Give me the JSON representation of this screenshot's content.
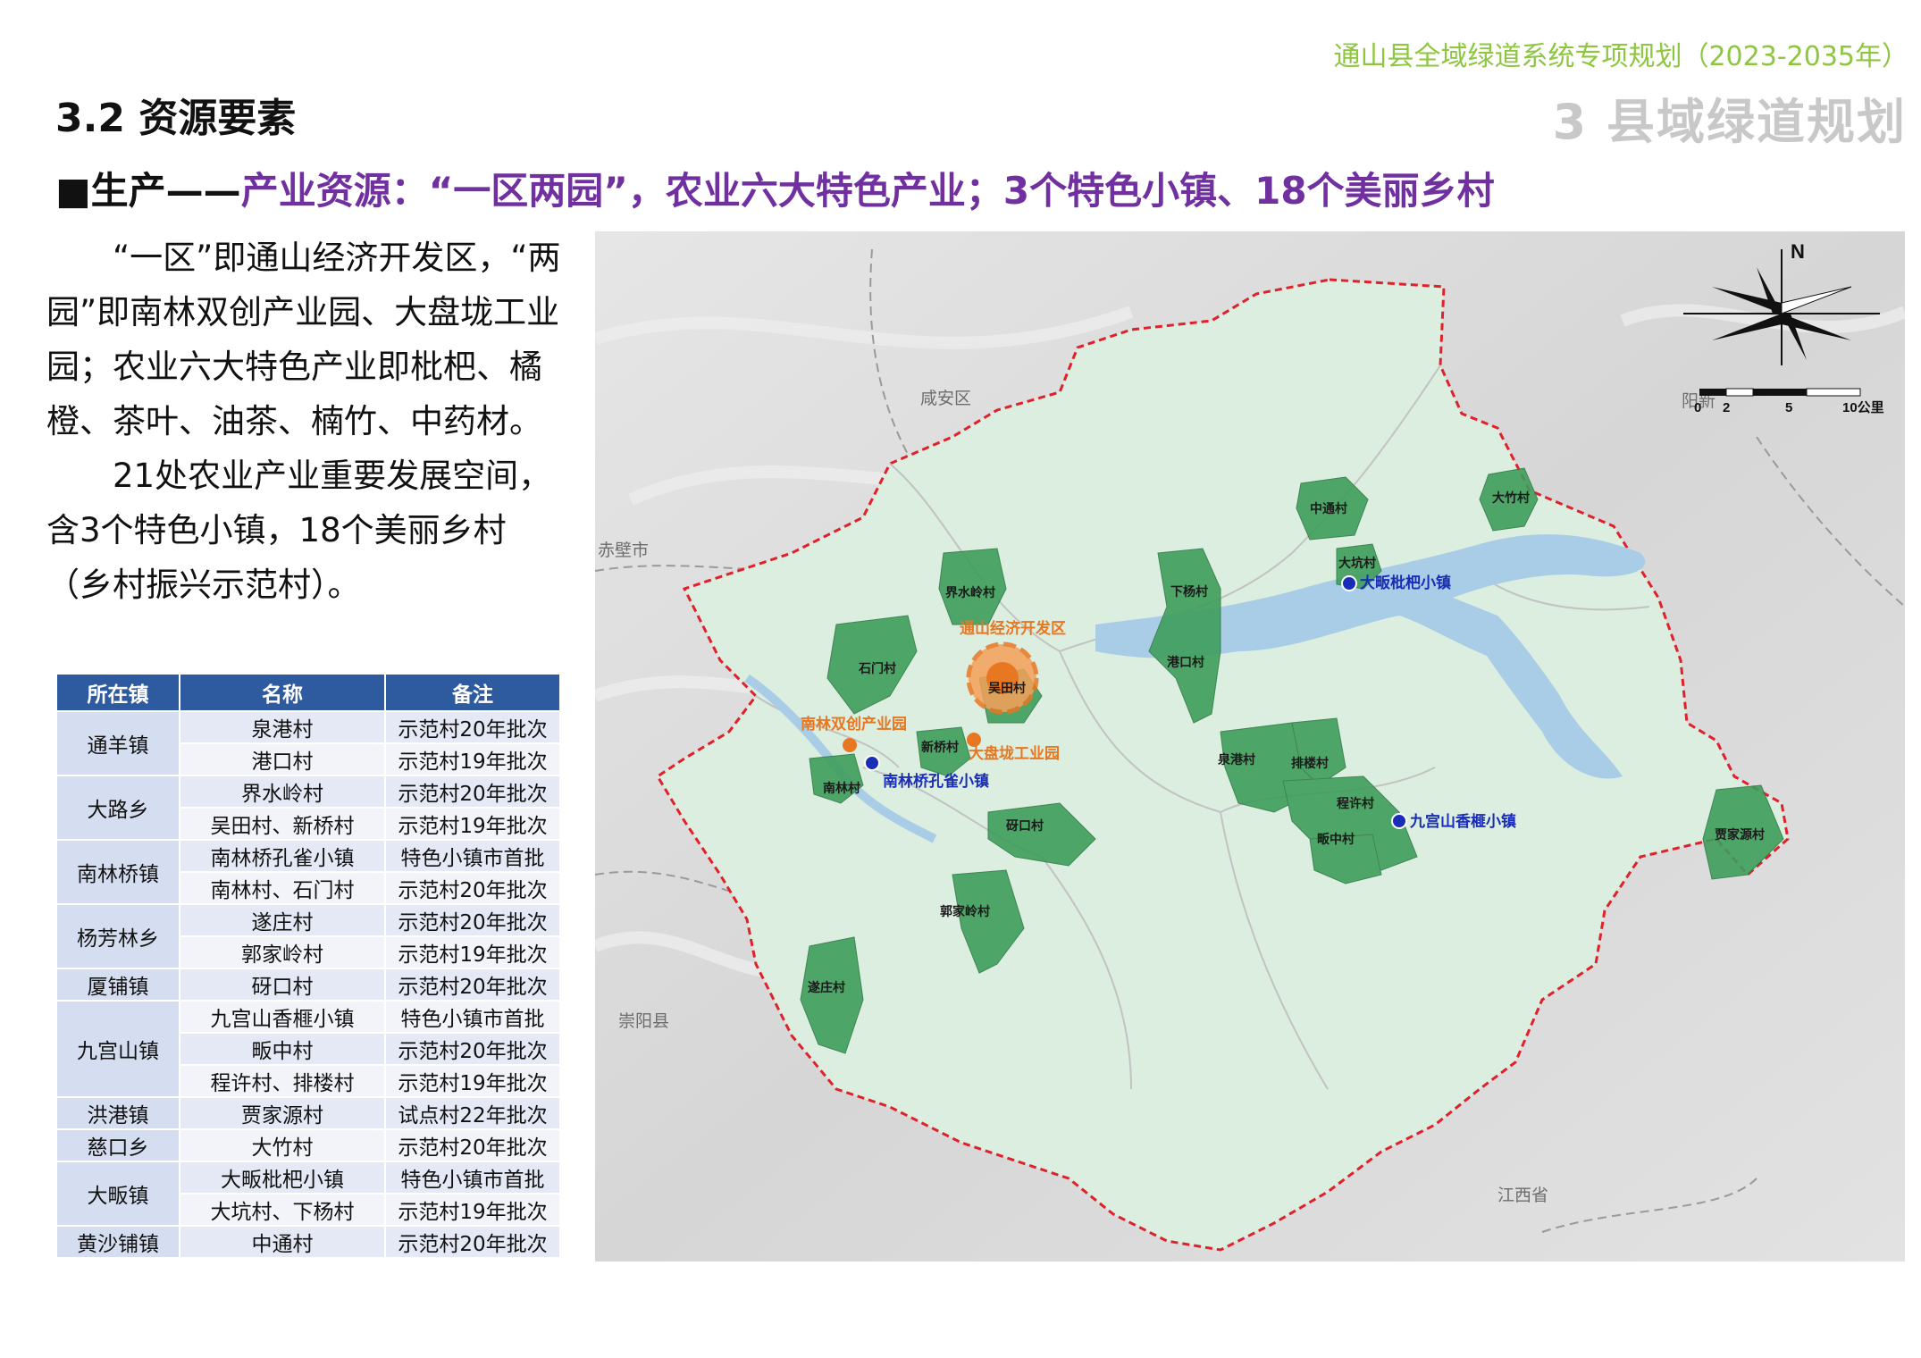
{
  "header": {
    "doc_title": "通山县全域绿道系统专项规划（2023-2035年）",
    "section_title": "3.2  资源要素",
    "chapter_title": "3  县域绿道规划"
  },
  "headline": {
    "lead": "■生产——",
    "highlight": "产业资源：“一区两园”，农业六大特色产业；3个特色小镇、18个美丽乡村"
  },
  "body": {
    "paragraph1": "“一区”即通山经济开发区，“两园”即南林双创产业园、大盘垅工业园；农业六大特色产业即枇杷、橘橙、茶叶、油茶、楠竹、中药材。",
    "paragraph2": "21处农业产业重要发展空间，含3个特色小镇，18个美丽乡村（乡村振兴示范村）。"
  },
  "table": {
    "headers": [
      "所在镇",
      "名称",
      "备注"
    ],
    "groups": [
      {
        "town": "通羊镇",
        "rows": [
          [
            "泉港村",
            "示范村20年批次"
          ],
          [
            "港口村",
            "示范村19年批次"
          ]
        ]
      },
      {
        "town": "大路乡",
        "rows": [
          [
            "界水岭村",
            "示范村20年批次"
          ],
          [
            "吴田村、新桥村",
            "示范村19年批次"
          ]
        ]
      },
      {
        "town": "南林桥镇",
        "rows": [
          [
            "南林桥孔雀小镇",
            "特色小镇市首批"
          ],
          [
            "南林村、石门村",
            "示范村20年批次"
          ]
        ]
      },
      {
        "town": "杨芳林乡",
        "rows": [
          [
            "遂庄村",
            "示范村20年批次"
          ],
          [
            "郭家岭村",
            "示范村19年批次"
          ]
        ]
      },
      {
        "town": "厦铺镇",
        "rows": [
          [
            "砑口村",
            "示范村20年批次"
          ]
        ]
      },
      {
        "town": "九宫山镇",
        "rows": [
          [
            "九宫山香榧小镇",
            "特色小镇市首批"
          ],
          [
            "畈中村",
            "示范村20年批次"
          ],
          [
            "程许村、排楼村",
            "示范村19年批次"
          ]
        ]
      },
      {
        "town": "洪港镇",
        "rows": [
          [
            "贾家源村",
            "试点村22年批次"
          ]
        ]
      },
      {
        "town": "慈口乡",
        "rows": [
          [
            "大竹村",
            "示范村20年批次"
          ]
        ]
      },
      {
        "town": "大畈镇",
        "rows": [
          [
            "大畈枇杷小镇",
            "特色小镇市首批"
          ],
          [
            "大坑村、下杨村",
            "示范村19年批次"
          ]
        ]
      },
      {
        "town": "黄沙铺镇",
        "rows": [
          [
            "中通村",
            "示范村20年批次"
          ]
        ]
      }
    ]
  },
  "map": {
    "north": "N",
    "scale": {
      "ticks": [
        "0",
        "2",
        "5",
        "10公里"
      ]
    },
    "neighbors": {
      "xianan": "咸安区",
      "chibi": "赤壁市",
      "chongyang": "崇阳县",
      "yangxin": "阳新",
      "jiangxi": "江西省"
    },
    "zones": {
      "econ": "通山经济开发区",
      "nanlin_park": "南林双创产业园",
      "dapan_park": "大盘垅工业园"
    },
    "towns": {
      "nanlin": "南林桥孔雀小镇",
      "jiugong": "九宫山香榧小镇",
      "dafan": "大畈枇杷小镇"
    },
    "villages": {
      "zhongtong": "中通村",
      "dazhu": "大竹村",
      "dakeng": "大坑村",
      "jieshuiling": "界水岭村",
      "xiayang": "下杨村",
      "shimen": "石门村",
      "wutian": "吴田村",
      "gangkou": "港口村",
      "xinqiao": "新桥村",
      "nanlin": "南林村",
      "quangang": "泉港村",
      "pailou": "排楼村",
      "chengxu": "程许村",
      "fanzhong": "畈中村",
      "yakou": "砑口村",
      "guojialing": "郭家岭村",
      "suizhuang": "遂庄村",
      "jiajiayuan": "贾家源村"
    },
    "colors": {
      "boundary": "#e0202a",
      "village": "#3f9e5c",
      "county": "#dbeedf",
      "water": "#a9cde6",
      "town": "#1a2db8",
      "zone": "#e87722"
    }
  }
}
